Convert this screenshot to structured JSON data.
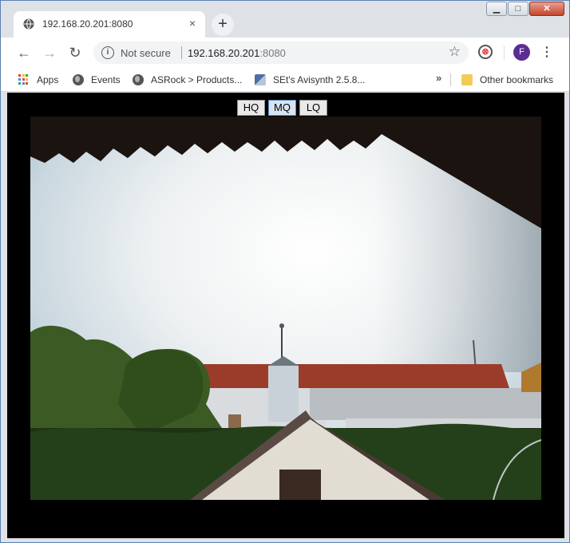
{
  "browser": {
    "tab": {
      "title": "192.168.20.201:8080",
      "close": "×"
    },
    "new_tab": "+",
    "window_controls": {
      "minimize": "▁",
      "maximize": "□",
      "close": "✕"
    }
  },
  "toolbar": {
    "back": "←",
    "forward": "→",
    "reload": "↻",
    "security_label": "Not secure",
    "url_host": "192.168.20.201",
    "url_port": ":8080",
    "star": "☆",
    "profile_initial": "F",
    "menu": "⋮",
    "extension": "⊗"
  },
  "bookmarks": {
    "items": [
      {
        "label": "Apps",
        "icon": "apps-grid-icon"
      },
      {
        "label": "Events",
        "icon": "globe-icon"
      },
      {
        "label": "ASRock > Products...",
        "icon": "globe-icon"
      },
      {
        "label": "SEt's Avisynth 2.5.8...",
        "icon": "document-icon"
      }
    ],
    "overflow": "»",
    "other_bookmarks": "Other bookmarks"
  },
  "page": {
    "quality_buttons": [
      "HQ",
      "MQ",
      "LQ"
    ],
    "active_quality": "MQ"
  },
  "colors": {
    "chrome_bg": "#dee1e6",
    "omnibox_bg": "#f1f3f4",
    "avatar": "#5c2d91",
    "page_bg": "#000000"
  }
}
